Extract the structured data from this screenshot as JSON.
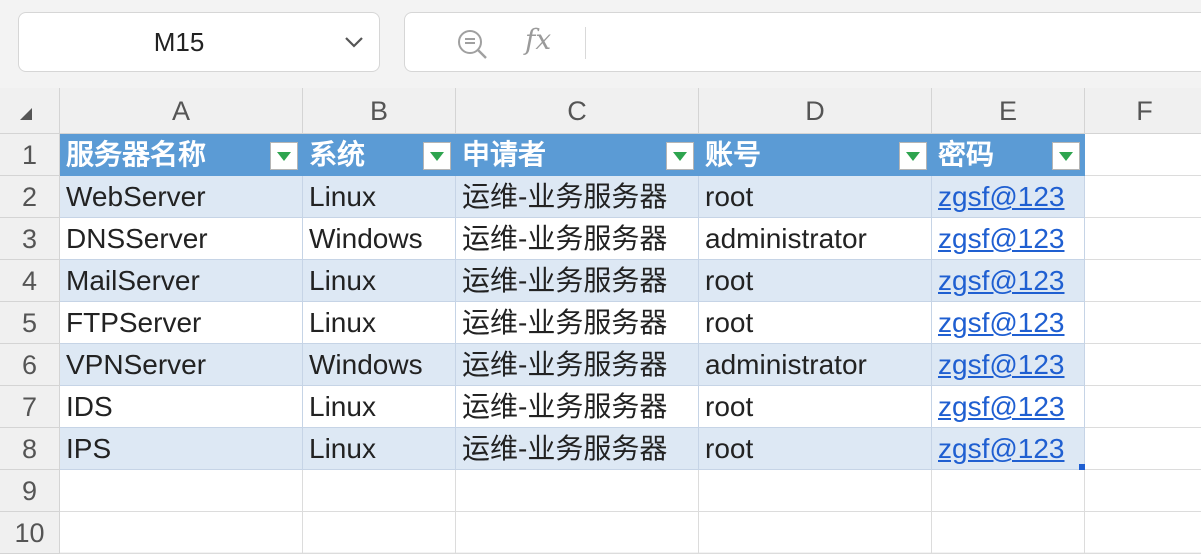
{
  "name_box": {
    "value": "M15"
  },
  "formula_bar": {
    "fx_label": "fx",
    "value": ""
  },
  "columns": [
    "A",
    "B",
    "C",
    "D",
    "E",
    "F"
  ],
  "rows": [
    "1",
    "2",
    "3",
    "4",
    "5",
    "6",
    "7",
    "8",
    "9",
    "10"
  ],
  "table": {
    "headers": [
      "服务器名称",
      "系统",
      "申请者",
      "账号",
      "密码"
    ],
    "data": [
      [
        "WebServer",
        "Linux",
        "运维-业务服务器",
        "root",
        "zgsf@123"
      ],
      [
        "DNSServer",
        "Windows",
        "运维-业务服务器",
        "administrator",
        "zgsf@123"
      ],
      [
        "MailServer",
        "Linux",
        "运维-业务服务器",
        "root",
        "zgsf@123"
      ],
      [
        "FTPServer",
        "Linux",
        "运维-业务服务器",
        "root",
        "zgsf@123"
      ],
      [
        "VPNServer",
        "Windows",
        "运维-业务服务器",
        "administrator",
        "zgsf@123"
      ],
      [
        "IDS",
        "Linux",
        "运维-业务服务器",
        "root",
        "zgsf@123"
      ],
      [
        "IPS",
        "Linux",
        "运维-业务服务器",
        "root",
        "zgsf@123"
      ]
    ]
  },
  "colors": {
    "table_header": "#5b9bd5",
    "band_row": "#dde8f4",
    "link": "#1f5fd1",
    "filter_arrow": "#2ea44f"
  }
}
